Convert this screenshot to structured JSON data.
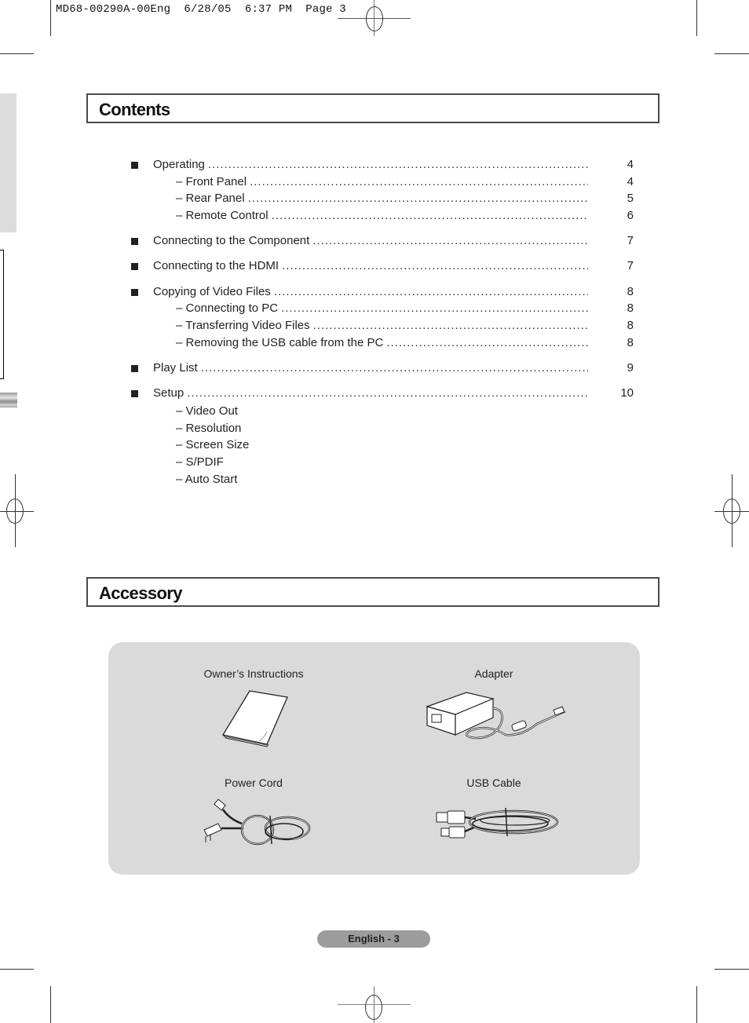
{
  "print_slug": "MD68-00290A-00Eng  6/28/05  6:37 PM  Page 3",
  "contents": {
    "title": "Contents",
    "entries": [
      {
        "label": "Operating",
        "page": "4",
        "level": 1,
        "gap": false
      },
      {
        "label": "– Front Panel",
        "page": "4",
        "level": 2,
        "gap": false
      },
      {
        "label": "– Rear Panel",
        "page": "5",
        "level": 2,
        "gap": false
      },
      {
        "label": "– Remote Control",
        "page": "6",
        "level": 2,
        "gap": false
      },
      {
        "label": "Connecting to the Component",
        "page": "7",
        "level": 1,
        "gap": true
      },
      {
        "label": "Connecting to the HDMI",
        "page": "7",
        "level": 1,
        "gap": true
      },
      {
        "label": "Copying of Video Files",
        "page": "8",
        "level": 1,
        "gap": true
      },
      {
        "label": "– Connecting to PC",
        "page": "8",
        "level": 2,
        "gap": false
      },
      {
        "label": "– Transferring Video Files",
        "page": "8",
        "level": 2,
        "gap": false
      },
      {
        "label": "– Removing the USB cable from the PC",
        "page": "8",
        "level": 2,
        "gap": false
      },
      {
        "label": "Play List",
        "page": "9",
        "level": 1,
        "gap": true
      },
      {
        "label": "Setup",
        "page": "10",
        "level": 1,
        "gap": true
      }
    ],
    "setup_subitems": [
      "– Video Out",
      "– Resolution",
      "– Screen Size",
      "– S/PDIF",
      "– Auto Start"
    ]
  },
  "accessory": {
    "title": "Accessory",
    "items": [
      {
        "name": "Owner’s Instructions",
        "icon": "manual-booklet-icon"
      },
      {
        "name": "Adapter",
        "icon": "power-adapter-icon"
      },
      {
        "name": "Power Cord",
        "icon": "power-cord-icon"
      },
      {
        "name": "USB Cable",
        "icon": "usb-cable-icon"
      }
    ]
  },
  "footer": {
    "page_label": "English - 3"
  },
  "colors": {
    "panel_bg": "#dadada",
    "pill_bg": "#9c9c9c",
    "title_border": "#4a4a4a"
  }
}
